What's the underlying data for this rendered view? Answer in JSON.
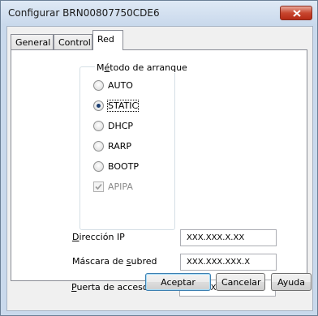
{
  "window": {
    "title": "Configurar BRN00807750CDE6"
  },
  "tabs": [
    {
      "label": "General",
      "active": false
    },
    {
      "label": "Control",
      "active": false
    },
    {
      "label": "Red",
      "active": true
    }
  ],
  "boot_method": {
    "legend_pre": "M",
    "legend_ul": "é",
    "legend_post": "todo de arranque",
    "options": [
      {
        "label": "AUTO",
        "checked": false,
        "enabled": true
      },
      {
        "label": "STATIC",
        "checked": true,
        "enabled": true
      },
      {
        "label": "DHCP",
        "checked": false,
        "enabled": true
      },
      {
        "label": "RARP",
        "checked": false,
        "enabled": true
      },
      {
        "label": "BOOTP",
        "checked": false,
        "enabled": true
      }
    ],
    "apipa": {
      "label": "APIPA",
      "checked": true,
      "enabled": false
    }
  },
  "fields": {
    "ip": {
      "label_ul": "D",
      "label_rest": "irección IP",
      "value": "XXX.XXX.X.XX"
    },
    "subnet": {
      "label_pre": "Máscara de ",
      "label_ul": "s",
      "label_post": "ubred",
      "value": "XXX.XXX.XXX.X"
    },
    "gateway": {
      "label_ul": "P",
      "label_rest": "uerta de acceso",
      "value": "XXX.XXX.X.X"
    }
  },
  "buttons": {
    "ok": "Aceptar",
    "cancel": "Cancelar",
    "help": "Ayuda"
  },
  "colors": {
    "titlebar": "#c9d9ec",
    "close_button": "#c8472f",
    "default_button_border": "#3c7fb1"
  }
}
